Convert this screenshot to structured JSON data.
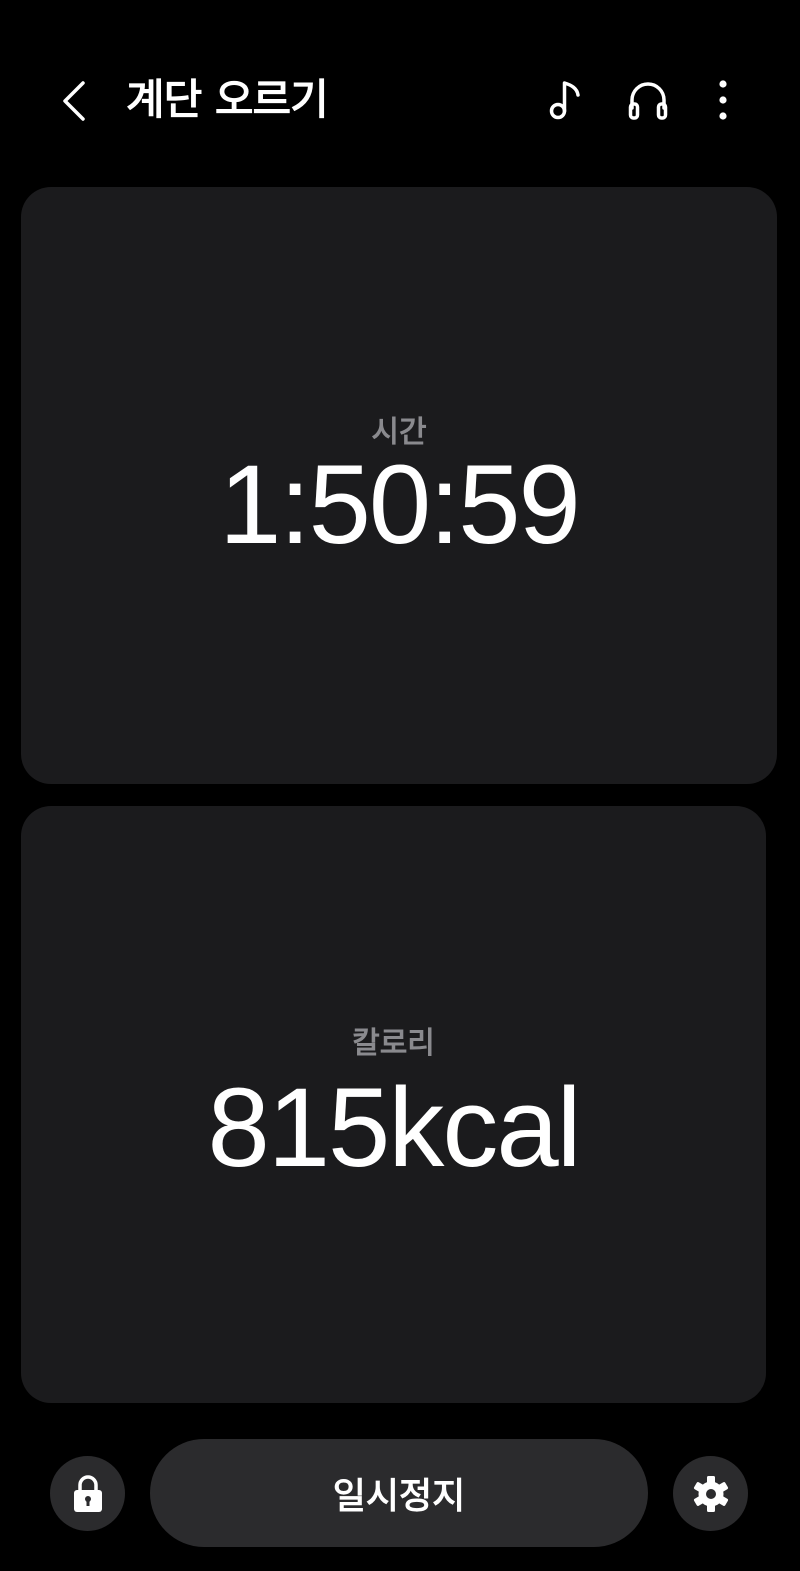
{
  "header": {
    "title": "계단 오르기",
    "icons": [
      "back-icon",
      "music-note-icon",
      "headphones-icon",
      "more-vertical-icon"
    ]
  },
  "cards": [
    {
      "label": "시간",
      "value": "1:50:59"
    },
    {
      "label": "칼로리",
      "value": "815kcal"
    }
  ],
  "controls": {
    "pause_label": "일시정지",
    "icons": [
      "lock-icon",
      "gear-icon"
    ]
  },
  "colors": {
    "background": "#000000",
    "card": "#1b1b1d",
    "button": "#2b2b2d",
    "label": "#8a8a8e",
    "text": "#ffffff"
  }
}
